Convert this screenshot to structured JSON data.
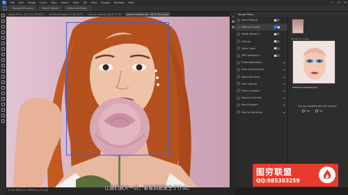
{
  "menubar": {
    "items": [
      "File",
      "Edit",
      "Image",
      "Layer",
      "Type",
      "Select",
      "Filter",
      "3D",
      "View",
      "Plugins",
      "Window",
      "Help"
    ],
    "controls": [
      "—",
      "☐",
      "✕"
    ]
  },
  "optbar": {
    "options": [
      "Sample All Layers",
      "Select Subject",
      "Select and Mask..."
    ]
  },
  "tabs": [
    {
      "label": "photo-1520... @ 12.5% (RGB/8*)",
      "active": false
    },
    {
      "label": "No Result Sphere 11 @ 16.7%",
      "active": false
    },
    {
      "label": "makeup example.jpg @ 33.3%",
      "active": false
    },
    {
      "label": "pexels-christian-bla... @ 12.5% (Layer 0, RGB/8*)",
      "active": true
    }
  ],
  "status": {
    "text": "12.5%    4000 px x 6000 px (72 ppi)"
  },
  "neural_filters": {
    "title": "Neural Filters",
    "filters": [
      {
        "label": "Smart Portrait",
        "active": false,
        "toggle": "off"
      },
      {
        "label": "Makeup Transfer",
        "active": true,
        "toggle": "on"
      },
      {
        "label": "Depth Aware H...",
        "active": false,
        "toggle": "off"
      },
      {
        "label": "Colorize",
        "active": false,
        "toggle": "off"
      },
      {
        "label": "Super Zoom",
        "active": false,
        "toggle": "off"
      },
      {
        "label": "JPEG Artifacts R...",
        "active": false,
        "toggle": "off"
      },
      {
        "label": "Photo Restoration",
        "active": false,
        "toggle": "none"
      },
      {
        "label": "Dust and Scratches",
        "active": false,
        "toggle": "none"
      },
      {
        "label": "Noise Reduction",
        "active": false,
        "toggle": "none"
      },
      {
        "label": "Face Cleanup",
        "active": false,
        "toggle": "none"
      },
      {
        "label": "Photo to Sketch",
        "active": false,
        "toggle": "none"
      },
      {
        "label": "Sketch to Portrait",
        "active": false,
        "toggle": "none"
      },
      {
        "label": "Pencil Artwork",
        "active": false,
        "toggle": "none"
      },
      {
        "label": "Face to Caricature",
        "active": false,
        "toggle": "none"
      }
    ],
    "detail": {
      "sample_label": "Reference Image",
      "sample_name": "makeup example.jpg",
      "survey_question": "Are you satisfied with the results?",
      "survey_yes": "Yes",
      "survey_no": "No"
    }
  },
  "subtitle": "让我们放大一点，看看到底发生了什么。",
  "watermark": {
    "title": "图穷联盟",
    "qq": "QQ:985303259"
  }
}
